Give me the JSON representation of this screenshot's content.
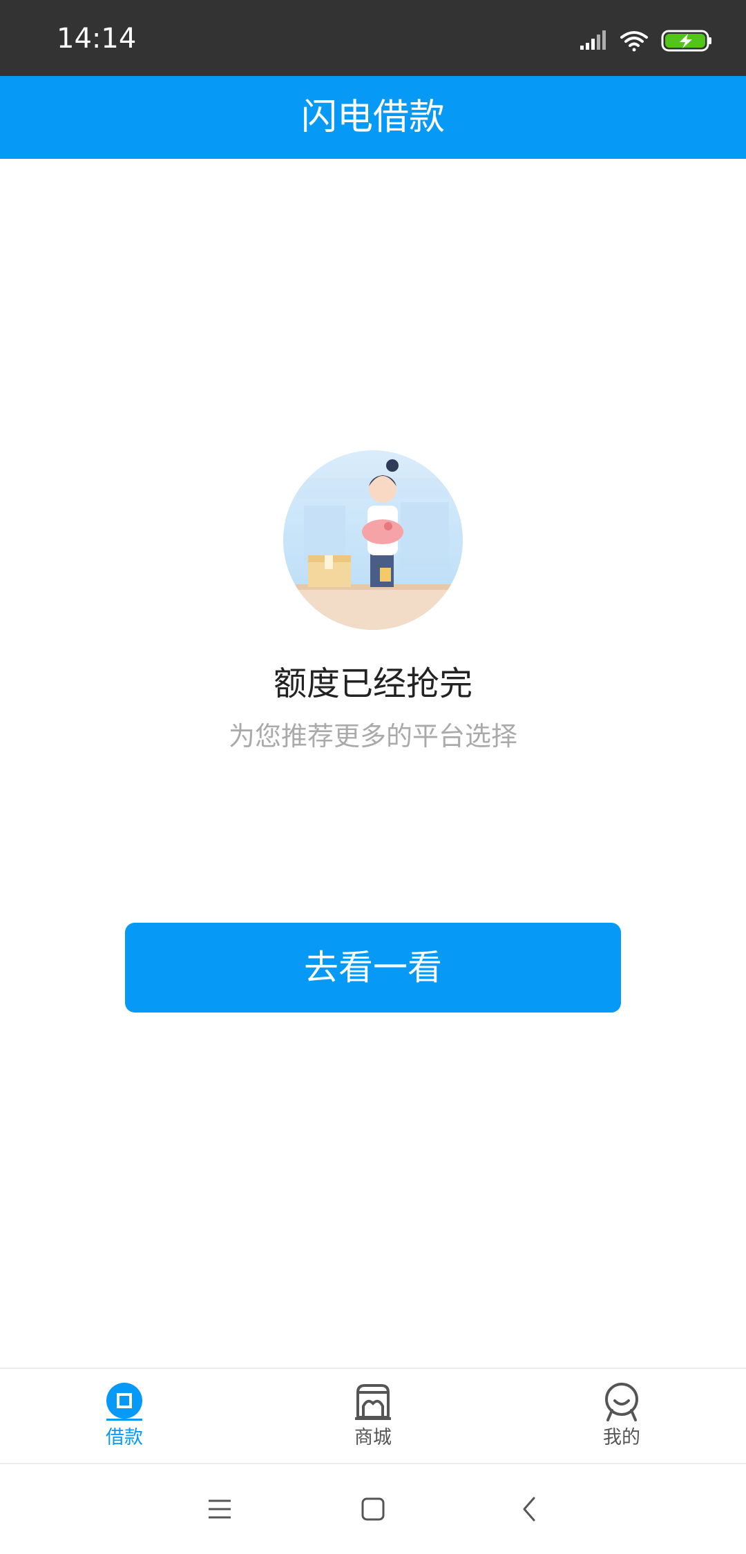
{
  "status_bar": {
    "time": "14:14",
    "icons": [
      "signal-icon",
      "wifi-icon",
      "battery-charging-icon"
    ]
  },
  "header": {
    "title": "闪电借款"
  },
  "empty_state": {
    "illustration": "shop-clerk-illustration",
    "title": "额度已经抢完",
    "subtitle": "为您推荐更多的平台选择"
  },
  "action": {
    "button_label": "去看一看"
  },
  "tab_bar": {
    "tabs": [
      {
        "label": "借款",
        "icon": "loan-icon",
        "active": true
      },
      {
        "label": "商城",
        "icon": "store-icon",
        "active": false
      },
      {
        "label": "我的",
        "icon": "profile-icon",
        "active": false
      }
    ]
  },
  "system_nav": {
    "buttons": [
      "menu-icon",
      "home-icon",
      "back-icon"
    ]
  },
  "colors": {
    "accent": "#0699f5",
    "status_bar": "#333333",
    "title_text": "#222222",
    "subtitle_text": "#aaaaaa",
    "battery": "#52c41a"
  }
}
